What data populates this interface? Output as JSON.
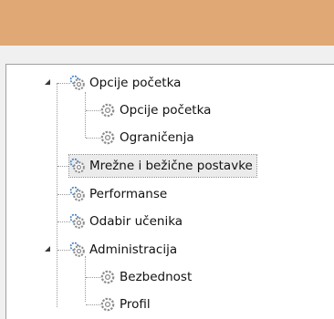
{
  "tree": {
    "items": [
      {
        "label": "Opcije početka",
        "icon": "gear-group-icon",
        "expanded": true
      },
      {
        "label": "Opcije početka",
        "icon": "gear-icon"
      },
      {
        "label": "Ograničenja",
        "icon": "gear-icon"
      },
      {
        "label": "Mrežne i bežične postavke",
        "icon": "gear-group-icon",
        "selected": true
      },
      {
        "label": "Performanse",
        "icon": "gear-group-icon"
      },
      {
        "label": "Odabir učenika",
        "icon": "gear-group-icon"
      },
      {
        "label": "Administracija",
        "icon": "gear-group-icon",
        "expanded": true
      },
      {
        "label": "Bezbednost",
        "icon": "gear-icon"
      },
      {
        "label": "Profil",
        "icon": "gear-icon"
      }
    ]
  },
  "colors": {
    "titlebar": "#e0a874",
    "selection": "#ebebeb",
    "gear_blue": "#3d7fc6",
    "gear_gray": "#8c8c8c"
  }
}
